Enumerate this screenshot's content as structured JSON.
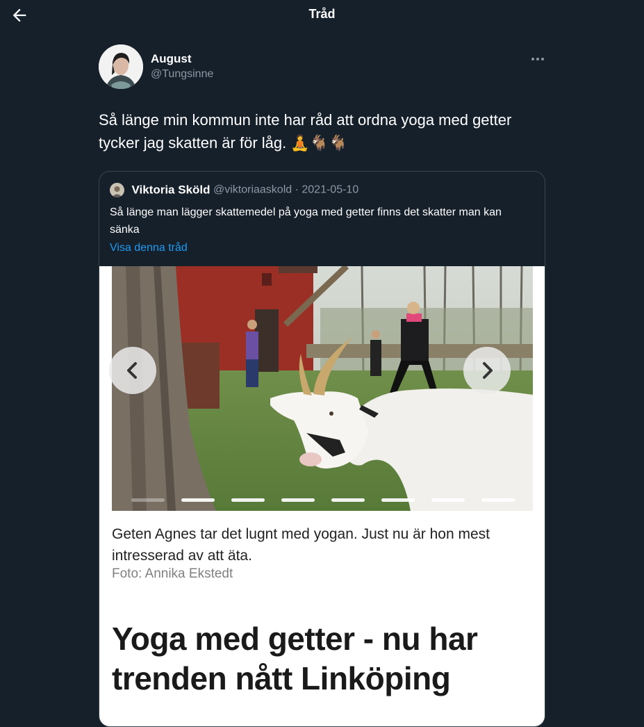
{
  "header": {
    "title": "Tråd",
    "back_icon": "arrow-left-icon"
  },
  "tweet": {
    "author_name": "August",
    "author_handle": "@Tungsinne",
    "more_icon": "more-horizontal-icon",
    "text": "Så länge min kommun inte har råd att ordna yoga med getter tycker jag skatten är för låg. 🧘🐐🐐"
  },
  "quote": {
    "author_name": "Viktoria Sköld",
    "author_handle": "@viktoriaaskold",
    "separator": "·",
    "date": "2021-05-10",
    "text": "Så länge man lägger skattemedel på yoga med getter finns det skatter man kan sänka",
    "thread_link": "Visa denna tråd"
  },
  "article": {
    "carousel": {
      "prev_icon": "chevron-left-icon",
      "next_icon": "chevron-right-icon",
      "slide_count": 8,
      "active_slide": 1
    },
    "caption": "Geten Agnes tar det lugnt med yogan. Just nu är hon mest intresserad av att äta.",
    "credit": "Foto: Annika Ekstedt",
    "headline": "Yoga med getter - nu har trenden nått Linköping"
  },
  "colors": {
    "background": "#15202b",
    "border": "#38444d",
    "muted_text": "#8b98a5",
    "link": "#1d9bf0"
  }
}
